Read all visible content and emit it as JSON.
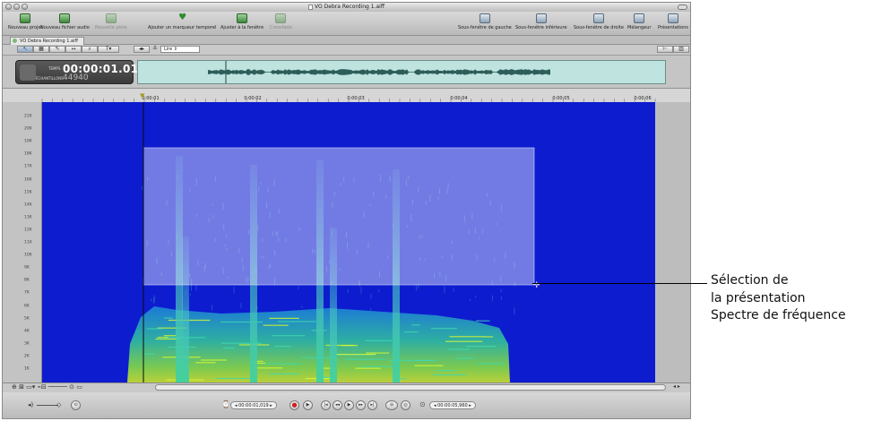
{
  "window": {
    "title": "VO Debra Recording 1.aiff"
  },
  "toolbar": {
    "left_buttons": [
      {
        "label": "Nouveau projet",
        "icon": "new-project-icon",
        "enabled": true
      },
      {
        "label": "Nouveau fichier audio",
        "icon": "new-audio-file-icon",
        "enabled": true
      },
      {
        "label": "Nouvelle piste",
        "icon": "new-track-icon",
        "enabled": false
      },
      {
        "label": "Ajouter un marqueur temporel",
        "icon": "time-marker-icon",
        "enabled": true
      },
      {
        "label": "Ajuster à la fenêtre",
        "icon": "fit-window-icon",
        "enabled": true
      },
      {
        "label": "Crossfade",
        "icon": "crossfade-icon",
        "enabled": false
      }
    ],
    "right_buttons": [
      {
        "label": "Sous-fenêtre de gauche",
        "icon": "left-pane-icon"
      },
      {
        "label": "Sous-fenêtre inférieure",
        "icon": "bottom-pane-icon"
      },
      {
        "label": "Sous-fenêtre de droite",
        "icon": "right-pane-icon"
      },
      {
        "label": "Mélangeur",
        "icon": "mixer-icon"
      },
      {
        "label": "Présentations",
        "icon": "layouts-icon"
      }
    ]
  },
  "tab": {
    "label": "VO Debra Recording 1.aiff"
  },
  "tools": {
    "playhead_mode": "Lire"
  },
  "overview": {
    "time_label": "TEMPS",
    "time_value": "00:00:01.01",
    "sample_label": "ÉCHANTILLONS",
    "sample_value": "44940"
  },
  "ruler": {
    "ticks": [
      "0:00:01",
      "0:00:02",
      "0:00:03",
      "0:00:04",
      "0:00:05",
      "0:00:06"
    ]
  },
  "frequency_axis": {
    "labels": [
      "21K",
      "20K",
      "19K",
      "18K",
      "17K",
      "16K",
      "15K",
      "14K",
      "13K",
      "12K",
      "11K",
      "10K",
      "9K",
      "8K",
      "7K",
      "6K",
      "5K",
      "4K",
      "3K",
      "2K",
      "1K"
    ]
  },
  "spectrum": {
    "background_color": "#0d1ccf",
    "selection_color": "#9aa6f0"
  },
  "transport": {
    "position_timecode": "00:00:01,019",
    "length_timecode": "00:00:05,960"
  },
  "callout": {
    "lines": [
      "Sélection de",
      "la présentation",
      "Spectre de fréquence"
    ]
  }
}
